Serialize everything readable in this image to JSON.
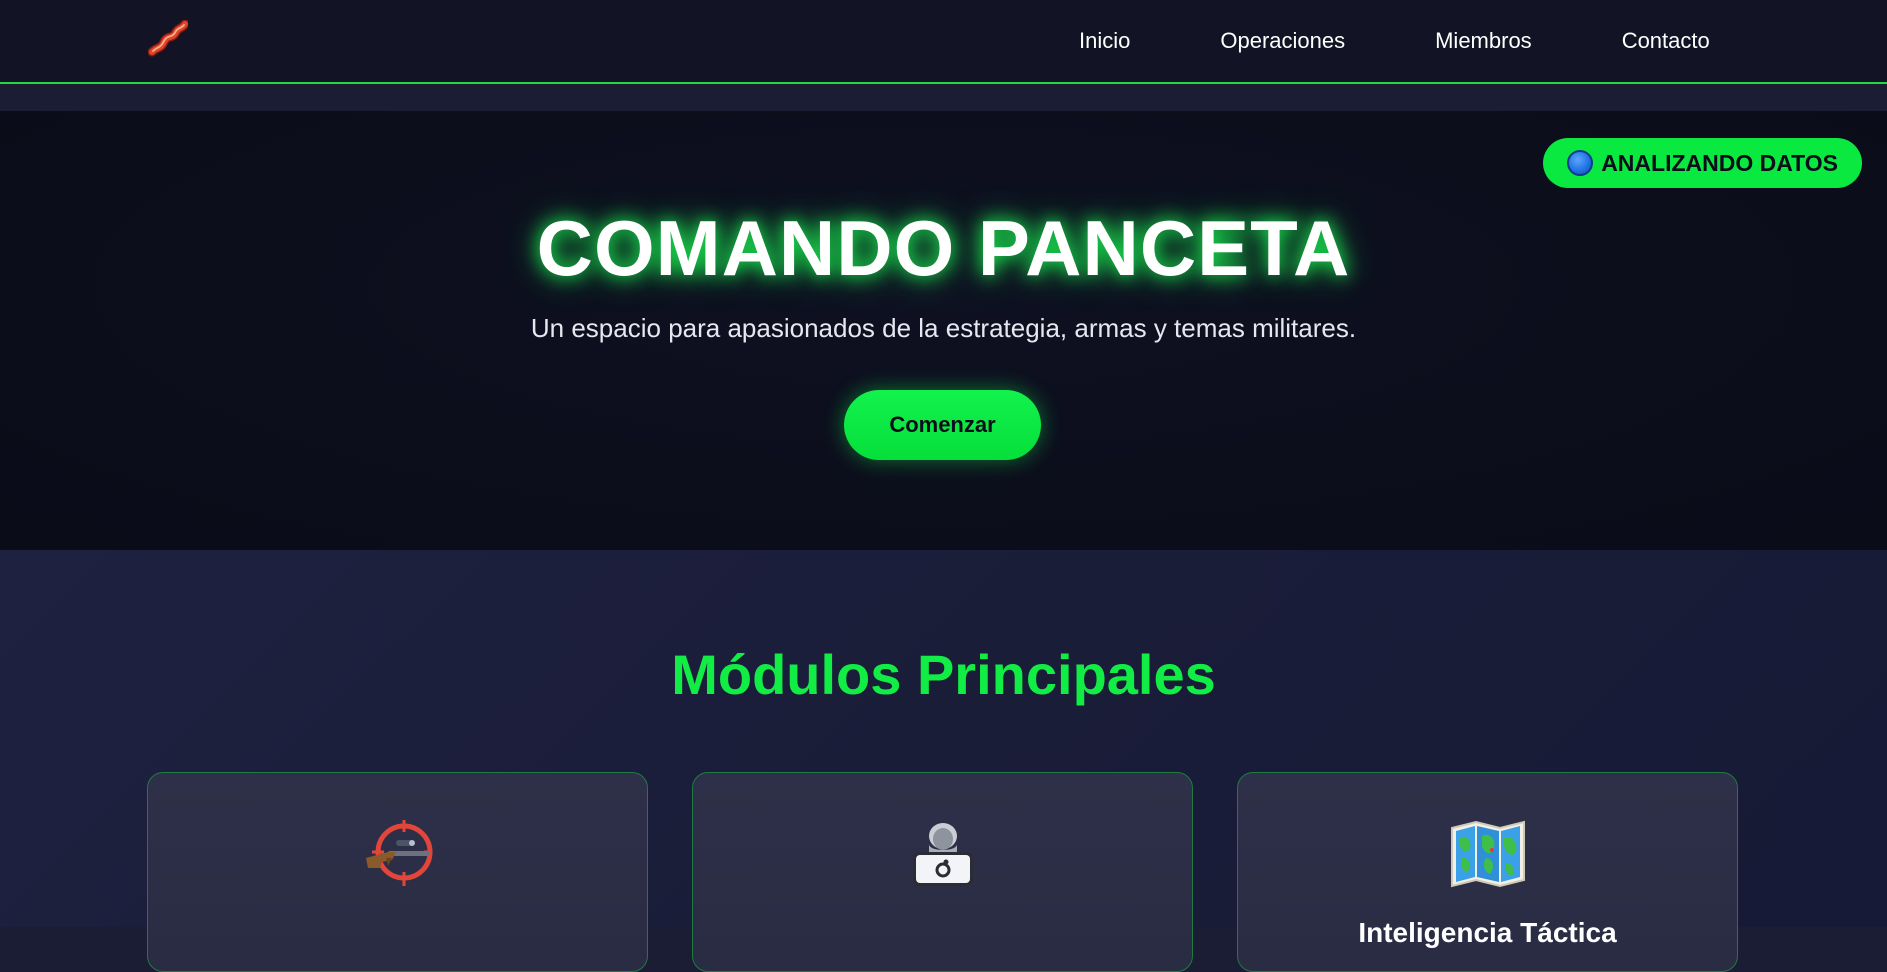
{
  "navbar": {
    "logo_icon": "bacon-icon",
    "links": [
      {
        "label": "Inicio"
      },
      {
        "label": "Operaciones"
      },
      {
        "label": "Miembros"
      },
      {
        "label": "Contacto"
      }
    ]
  },
  "hero": {
    "status_badge": "ANALIZANDO DATOS",
    "status_icon": "blue-circle-icon",
    "title": "COMANDO PANCETA",
    "subtitle": "Un espacio para apasionados de la estrategia, armas y temas militares.",
    "cta_label": "Comenzar"
  },
  "modules": {
    "title": "Módulos Principales",
    "cards": [
      {
        "icon": "sniper-rifle-crosshair-icon",
        "title": ""
      },
      {
        "icon": "hacker-laptop-icon",
        "title": ""
      },
      {
        "icon": "world-map-icon",
        "title": "Inteligencia Táctica"
      }
    ]
  },
  "colors": {
    "accent_green": "#0ae93f",
    "nav_bg": "#121425",
    "hero_bg": "#0b0d1a",
    "section_bg": "#1c1f3b",
    "card_bg": "#2c2e46",
    "card_border": "#1f7a44"
  }
}
